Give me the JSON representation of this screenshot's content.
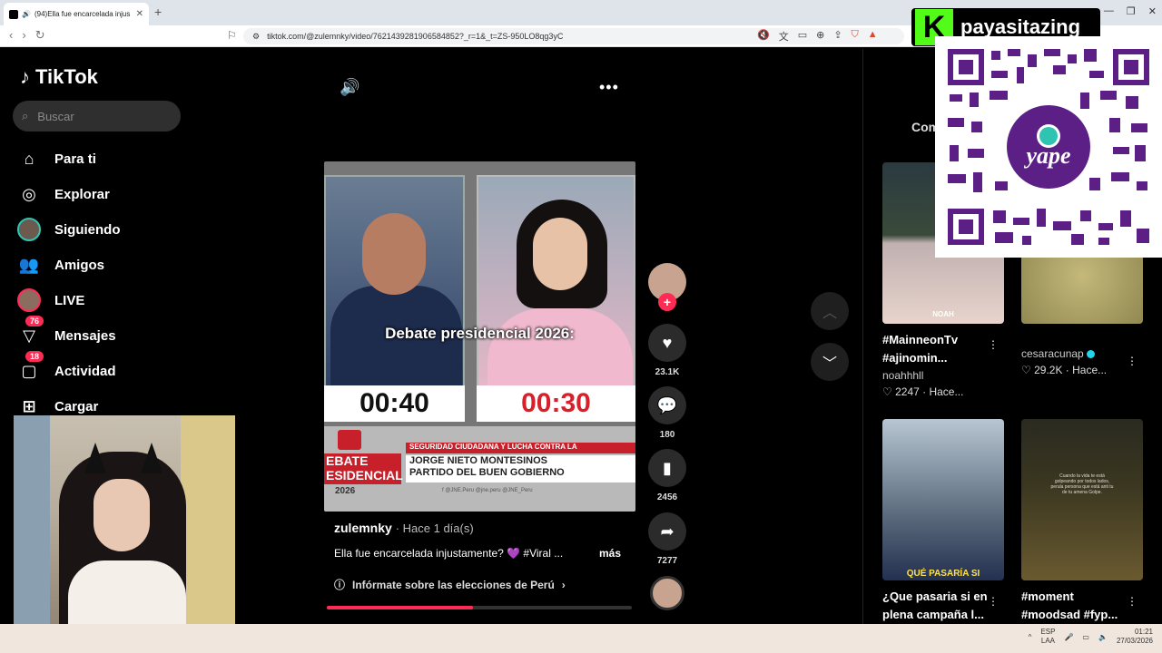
{
  "browser": {
    "tab_title": "(94)Ella fue encarcelada injus",
    "url": "tiktok.com/@zulemnky/video/7621439281906584852?_r=1&_t=ZS-950LO8qg3yC"
  },
  "sidebar": {
    "logo": "TikTok",
    "search_placeholder": "Buscar",
    "items": [
      {
        "label": "Para ti",
        "icon": "home-icon"
      },
      {
        "label": "Explorar",
        "icon": "compass-icon"
      },
      {
        "label": "Siguiendo",
        "icon": "following-avatar-icon"
      },
      {
        "label": "Amigos",
        "icon": "friends-icon"
      },
      {
        "label": "LIVE",
        "icon": "live-avatar-icon"
      },
      {
        "label": "Mensajes",
        "icon": "messages-icon",
        "badge": "76"
      },
      {
        "label": "Actividad",
        "icon": "activity-icon",
        "badge": "18"
      },
      {
        "label": "Cargar",
        "icon": "upload-icon"
      }
    ]
  },
  "video": {
    "caption": "Debate presidencial 2026:",
    "timer_left": "00:40",
    "timer_right": "00:30",
    "banner_debate": "EBATE",
    "banner_debate2": "ESIDENCIAL",
    "banner_year": "2026",
    "banner_topic": "SEGURIDAD CIUDADANA Y LUCHA CONTRA LA",
    "banner_name_line1": "JORGE NIETO MONTESINOS",
    "banner_name_line2": "PARTIDO DEL BUEN GOBIERNO",
    "banner_handles": "f @JNE.Peru   @jne.peru   @JNE_Peru",
    "author": "zulemnky",
    "posted": "· Hace 1 día(s)",
    "description": "Ella fue encarcelada injustamente? 💜 #Viral ...",
    "more_label": "más",
    "info_label": "Infórmate sobre las elecciones de Perú",
    "progress": 0.48
  },
  "actions": {
    "likes": "23.1K",
    "comments": "180",
    "saves": "2456",
    "shares": "7277"
  },
  "right_panel": {
    "tab_label": "Com",
    "cards": [
      {
        "title": "#MainneonTv #ajinomin...",
        "user": "noahhhll",
        "stats": "2247 · Hace...",
        "thumb_text": "NOAH"
      },
      {
        "title": "",
        "user": "cesaracunap",
        "stats": "29.2K · Hace...",
        "thumb_text": ""
      },
      {
        "title": "¿Que pasaria si en plena campaña l...",
        "user": "",
        "stats": "",
        "thumb_text": "QUÉ PASARÍA SI"
      },
      {
        "title": "#moment #moodsad #fyp...",
        "user": "",
        "stats": "",
        "thumb_text": "Cuando la vida te está golpeando por todos lados, perula persona que está anti tu de tu amena Golpe."
      }
    ]
  },
  "overlays": {
    "kick_logo": "K",
    "kick_name": "payasitazing",
    "yape_label": "yape"
  },
  "taskbar": {
    "lang_top": "ESP",
    "lang_bottom": "LAA",
    "time": "01:21",
    "date": "27/03/2026"
  }
}
